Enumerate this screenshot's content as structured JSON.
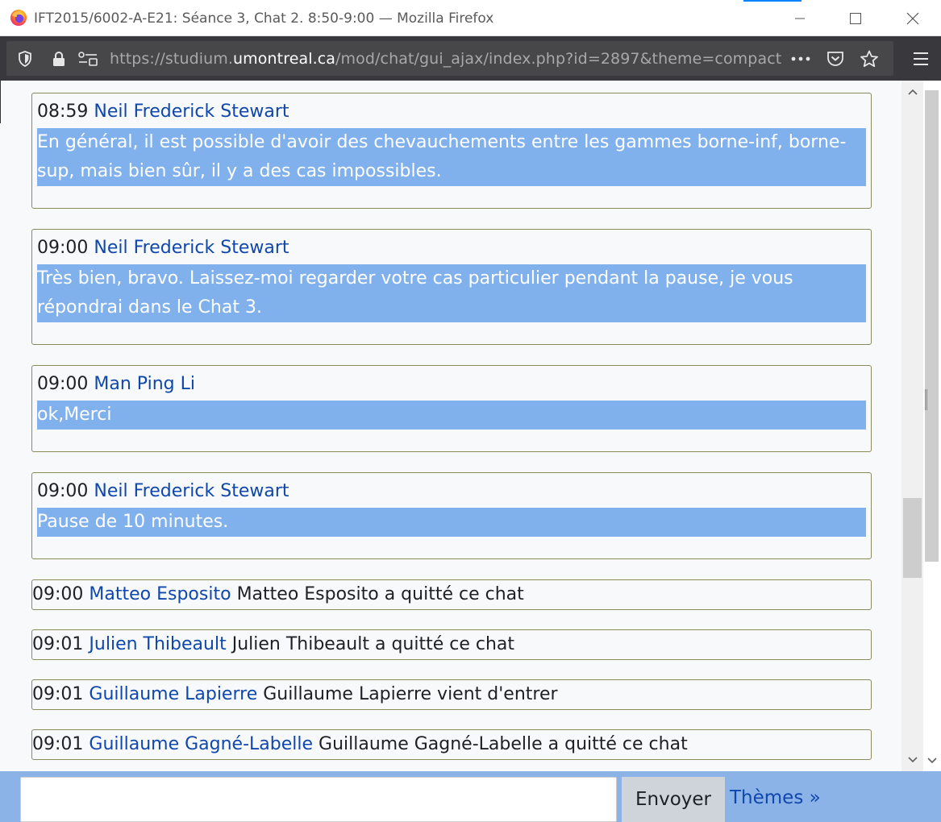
{
  "window": {
    "title": "IFT2015/6002-A-E21: Séance 3, Chat 2. 8:50-9:00 — Mozilla Firefox"
  },
  "toolbar": {
    "url_prefix": "https://studium.",
    "url_domain": "umontreal.ca",
    "url_path": "/mod/chat/gui_ajax/index.php?id=2897&theme=compact"
  },
  "messages": [
    {
      "time": "08:59",
      "user": "Neil Frederick Stewart",
      "text": "En général, il est possible d'avoir des chevauchements entre les gammes borne-inf, borne-sup, mais bien sûr, il y a des cas impossibles."
    },
    {
      "time": "09:00",
      "user": "Neil Frederick Stewart",
      "text": "Très bien, bravo. Laissez-moi regarder votre cas particulier pendant la pause, je vous répondrai dans le Chat 3."
    },
    {
      "time": "09:00",
      "user": "Man Ping Li",
      "text": "ok,Merci"
    },
    {
      "time": "09:00",
      "user": "Neil Frederick Stewart",
      "text": "Pause de 10 minutes."
    }
  ],
  "events": [
    {
      "time": "09:00",
      "user": "Matteo Esposito",
      "text": "Matteo Esposito a quitté ce chat"
    },
    {
      "time": "09:01",
      "user": "Julien Thibeault",
      "text": "Julien Thibeault a quitté ce chat"
    },
    {
      "time": "09:01",
      "user": "Guillaume Lapierre",
      "text": "Guillaume Lapierre vient d'entrer"
    },
    {
      "time": "09:01",
      "user": "Guillaume Gagné-Labelle",
      "text": "Guillaume Gagné-Labelle a quitté ce chat"
    }
  ],
  "input": {
    "value": "",
    "send_label": "Envoyer",
    "themes_label": "Thèmes »"
  },
  "colors": {
    "message_highlight": "#81b1ec",
    "username": "#0f47ad",
    "bottom_bar": "#8cb3e8",
    "toolbar": "#38383d"
  },
  "icons": [
    "firefox-logo-icon",
    "minimize-icon",
    "maximize-icon",
    "close-icon",
    "shield-icon",
    "lock-icon",
    "permissions-icon",
    "more-actions-icon",
    "pocket-icon",
    "bookmark-star-icon",
    "hamburger-menu-icon",
    "scroll-up-icon",
    "scroll-down-icon"
  ]
}
